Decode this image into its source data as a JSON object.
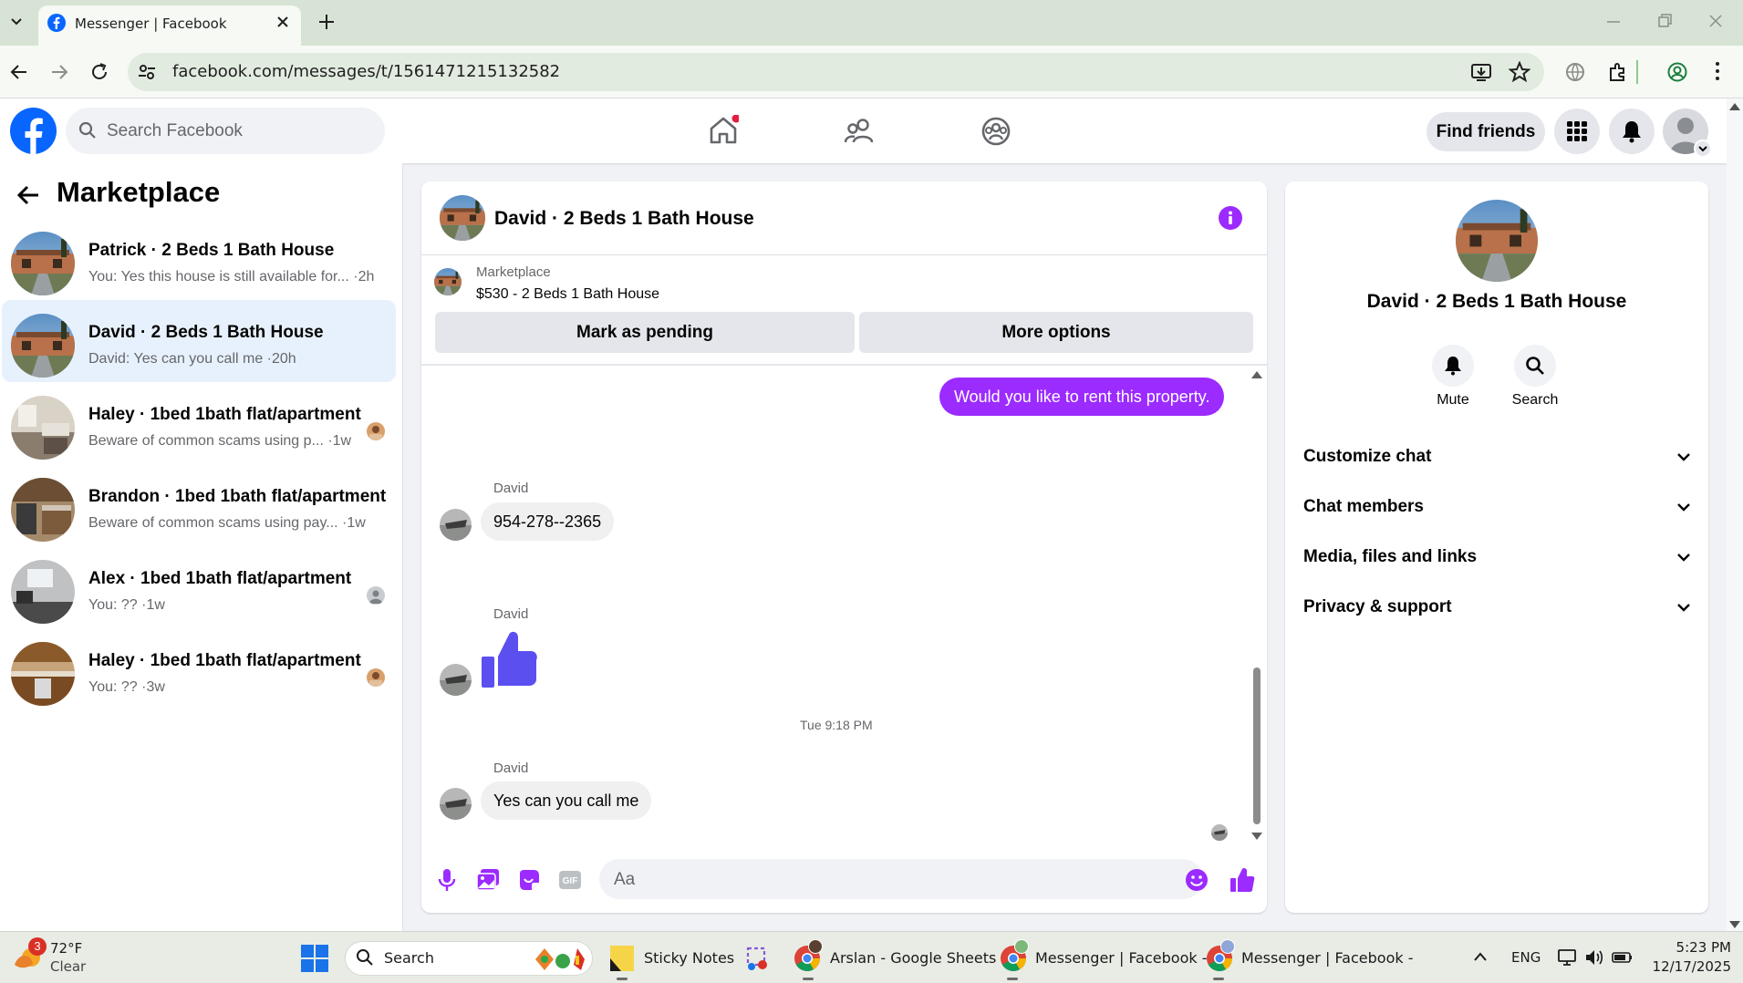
{
  "browser": {
    "tab_title": "Messenger | Facebook",
    "url": "facebook.com/messages/t/1561471215132582"
  },
  "fb": {
    "search_placeholder": "Search Facebook",
    "find_friends": "Find friends"
  },
  "sidebar": {
    "title": "Marketplace",
    "conversations": [
      {
        "name": "Patrick · 2 Beds 1 Bath House",
        "snippet": "You: Yes this house is still available for... ·2h",
        "thumb": "house"
      },
      {
        "name": "David · 2 Beds 1 Bath House",
        "snippet": "David: Yes can you call me ·20h",
        "thumb": "house",
        "active": true
      },
      {
        "name": "Haley · 1bed 1bath flat/apartment",
        "snippet": "Beware of common scams using p... ·1w",
        "thumb": "kitchen"
      },
      {
        "name": "Brandon · 1bed 1bath flat/apartment",
        "snippet": "Beware of common scams using pay... ·1w",
        "thumb": "kitchen2"
      },
      {
        "name": "Alex · 1bed 1bath flat/apartment",
        "snippet": "You: ?? ·1w",
        "thumb": "room"
      },
      {
        "name": "Haley · 1bed 1bath flat/apartment",
        "snippet": "You: ?? ·3w",
        "thumb": "kitchen3"
      }
    ]
  },
  "chat": {
    "title": "David · 2 Beds 1 Bath House",
    "listing": {
      "source": "Marketplace",
      "price_title": "$530 - 2 Beds 1 Bath House",
      "mark_pending": "Mark as pending",
      "more_options": "More options"
    },
    "messages": {
      "outgoing_1": "Would you like to rent this property.",
      "sender_1": "David",
      "incoming_1": "954-278--2365",
      "sender_2": "David",
      "sender_3": "David",
      "incoming_3": "Yes can you call me",
      "timestamp": "Tue 9:18 PM"
    },
    "composer_placeholder": "Aa",
    "accent": "#9b2bff"
  },
  "details": {
    "title": "David · 2 Beds 1 Bath House",
    "mute": "Mute",
    "search": "Search",
    "sections": [
      "Customize chat",
      "Chat members",
      "Media, files and links",
      "Privacy & support"
    ]
  },
  "taskbar": {
    "weather_temp": "72°F",
    "weather_desc": "Clear",
    "weather_badge": "3",
    "search": "Search",
    "apps": [
      "Sticky Notes",
      "Arslan - Google Sheets",
      "Messenger | Facebook -",
      "Messenger | Facebook -"
    ],
    "lang": "ENG",
    "time": "5:23 PM",
    "date": "12/17/2025"
  }
}
